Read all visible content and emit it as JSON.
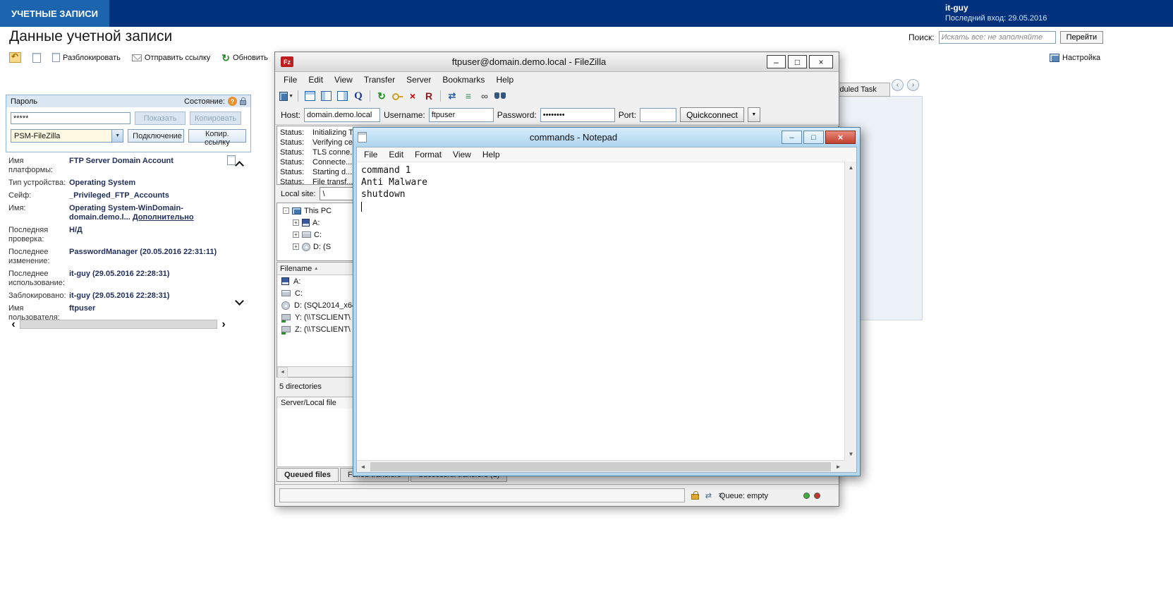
{
  "colors": {
    "header_bg": "#00317c",
    "header_tab_bg": "#1c64ae",
    "notepad_frame": "#b3d7ec",
    "notepad_close": "#c04130",
    "led_green": "#3fae3a",
    "led_red": "#c2382e",
    "value_text": "#23305c"
  },
  "glyphs": {
    "minimize": "–",
    "maximize": "□",
    "close": "×",
    "dropdown": "▼",
    "up": "▲",
    "down": "▼",
    "left": "◄",
    "right": "►",
    "chev_left": "‹",
    "chev_right": "›",
    "expand": "+",
    "collapse": "-",
    "refresh": "↻",
    "q": "Q",
    "r": "R",
    "x": "×",
    "compare": "⇄",
    "list": "≡",
    "infinity": "∞",
    "fz": "Fz",
    "sort": "▲",
    "question": "?"
  },
  "header": {
    "app_tab": "УЧЕТНЫЕ ЗАПИСИ",
    "username": "it-guy",
    "last_login": "Последний вход: 29.05.2016"
  },
  "page": {
    "title": "Данные учетной записи",
    "search": {
      "label": "Поиск:",
      "placeholder": "Искать все: не заполняйте",
      "go_button": "Перейти"
    },
    "settings": "Настройка",
    "actions": {
      "unlock": "Разблокировать",
      "send_link": "Отправить ссылку",
      "refresh": "Обновить"
    }
  },
  "account": {
    "password_label": "Пароль",
    "state_label": "Состояние:",
    "password_value": "*****",
    "show_button": "Показать",
    "copy_button": "Копировать",
    "connection_value": "PSM-FileZilla",
    "connect_button": "Подключение",
    "copy_link_button": "Копир. ссылку",
    "details": [
      {
        "label": "Имя платформы:",
        "value": "FTP Server Domain Account"
      },
      {
        "label": "Тип устройства:",
        "value": "Operating System"
      },
      {
        "label": "Сейф:",
        "value": "_Privileged_FTP_Accounts"
      },
      {
        "label": "Имя:",
        "value": "Operating System-WinDomain-domain.demo.l...",
        "link": "Дополнительно"
      },
      {
        "label": "Последняя проверка:",
        "value": "Н/Д"
      },
      {
        "label": "Последнее изменение:",
        "value": "PasswordManager (20.05.2016 22:31:11)"
      },
      {
        "label": "Последнее использование:",
        "value": "it-guy (29.05.2016 22:28:31)"
      },
      {
        "label": "Заблокировано:",
        "value": "it-guy (29.05.2016 22:28:31)"
      },
      {
        "label": "Имя пользователя:",
        "value": "ftpuser"
      }
    ]
  },
  "side_panel": {
    "tab": "Scheduled Task"
  },
  "filezilla": {
    "title": "ftpuser@domain.demo.local - FileZilla",
    "menus": [
      "File",
      "Edit",
      "View",
      "Transfer",
      "Server",
      "Bookmarks",
      "Help"
    ],
    "quickconnect": {
      "host_label": "Host:",
      "host_value": "domain.demo.local",
      "username_label": "Username:",
      "username_value": "ftpuser",
      "password_label": "Password:",
      "password_value": "••••••••",
      "port_label": "Port:",
      "port_value": "",
      "button_label": "Quickconnect"
    },
    "log": [
      {
        "type": "Status:",
        "message": "Initializing TLS..."
      },
      {
        "type": "Status:",
        "message": "Verifying ce..."
      },
      {
        "type": "Status:",
        "message": "TLS conne..."
      },
      {
        "type": "Status:",
        "message": "Connecte..."
      },
      {
        "type": "Status:",
        "message": "Starting d..."
      },
      {
        "type": "Status:",
        "message": "File transf..."
      }
    ],
    "local_site_label": "Local site:",
    "local_site_value": "\\",
    "tree_items": [
      "This PC",
      "A:",
      "C:",
      "D: (S"
    ],
    "filename_header": "Filename",
    "files": [
      "A:",
      "C:",
      "D: (SQL2014_x64",
      "Y: (\\\\TSCLIENT\\",
      "Z: (\\\\TSCLIENT\\"
    ],
    "dir_status": "5 directories",
    "queue_header": "Server/Local file",
    "tabs": [
      "Queued files",
      "Failed transfers",
      "Successful transfers (1)"
    ],
    "queue_status": "Queue: empty"
  },
  "notepad": {
    "title": "commands - Notepad",
    "menus": [
      "File",
      "Edit",
      "Format",
      "View",
      "Help"
    ],
    "lines": [
      "command 1",
      "Anti Malware",
      "shutdown"
    ]
  }
}
